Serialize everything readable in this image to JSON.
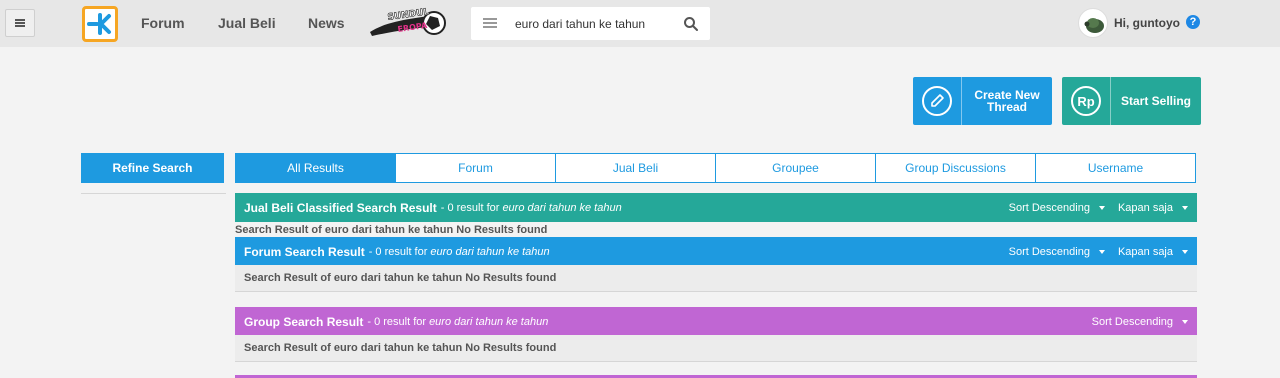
{
  "nav": {
    "links": [
      "Forum",
      "Jual Beli",
      "News"
    ],
    "promo_text": [
      "SUNDUL",
      "EROPA"
    ],
    "search_value": "euro dari tahun ke tahun",
    "greeting": "Hi, guntoyo",
    "help_label": "?"
  },
  "actions": {
    "create_thread": "Create New Thread",
    "start_selling": "Start Selling",
    "rp_label": "Rp"
  },
  "sidebar": {
    "refine_label": "Refine Search"
  },
  "tabs": [
    "All Results",
    "Forum",
    "Jual Beli",
    "Groupee",
    "Group Discussions",
    "Username"
  ],
  "sections": {
    "jualbeli": {
      "title": "Jual Beli Classified Search Result",
      "meta": "- 0 result for",
      "query": "euro dari tahun ke tahun",
      "sort": "Sort Descending",
      "time": "Kapan saja",
      "message": "Search Result of euro dari tahun ke tahun No Results found"
    },
    "forum": {
      "title": "Forum Search Result",
      "meta": "- 0 result for",
      "query": "euro dari tahun ke tahun",
      "sort": "Sort Descending",
      "time": "Kapan saja",
      "message": "Search Result of euro dari tahun ke tahun No Results found"
    },
    "group": {
      "title": "Group Search Result",
      "meta": "- 0 result for",
      "query": "euro dari tahun ke tahun",
      "sort": "Sort Descending",
      "message": "Search Result of euro dari tahun ke tahun No Results found"
    }
  },
  "colors": {
    "brand_blue": "#1e9ae0",
    "teal": "#25a899",
    "purple": "#c066d3",
    "logo_orange": "#f6a623"
  },
  "icons": [
    "menu-icon",
    "kaskus-logo-icon",
    "search-icon",
    "pencil-icon",
    "rupiah-icon",
    "help-icon",
    "chevron-down-icon"
  ]
}
